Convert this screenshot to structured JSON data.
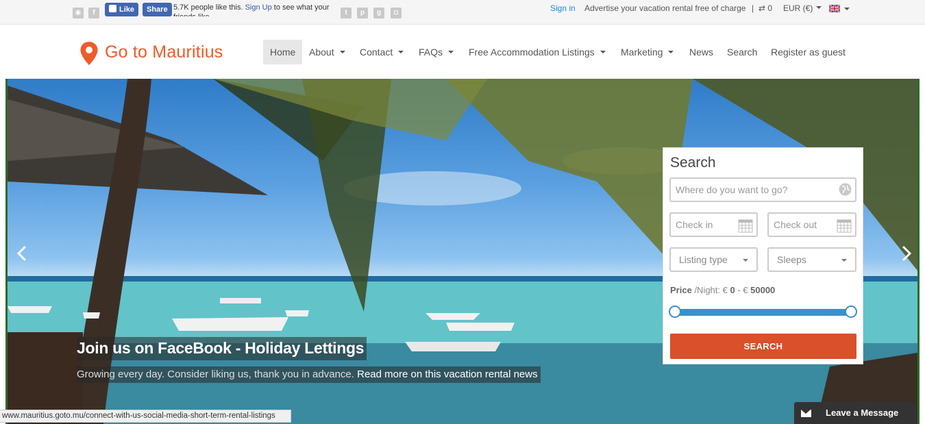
{
  "topbar": {
    "facebook": {
      "like_label": "Like",
      "share_label": "Share",
      "text_count": "5.7K people like this.",
      "text_signup": "Sign Up",
      "text_rest": "to see what your friends like."
    },
    "signin": "Sign in",
    "advertise": "Advertise your vacation rental free of charge",
    "compare_count": "0",
    "currency": "EUR (€)"
  },
  "header": {
    "logo_text": "Go to Mauritius",
    "nav": [
      {
        "label": "Home",
        "active": true
      },
      {
        "label": "About",
        "dropdown": true
      },
      {
        "label": "Contact",
        "dropdown": true
      },
      {
        "label": "FAQs",
        "dropdown": true
      },
      {
        "label": "Free Accommodation Listings",
        "dropdown": true
      },
      {
        "label": "Marketing",
        "dropdown": true
      },
      {
        "label": "News"
      },
      {
        "label": "Search"
      },
      {
        "label": "Register as guest"
      }
    ]
  },
  "hero": {
    "title": "Join us on FaceBook - Holiday Lettings",
    "subtitle": "Growing every day. Consider liking us, thank you in advance.",
    "read_more": "Read more on this vacation rental news"
  },
  "search": {
    "title": "Search",
    "where_placeholder": "Where do you want to go?",
    "checkin_placeholder": "Check in",
    "checkout_placeholder": "Check out",
    "listing_type": "Listing type",
    "sleeps": "Sleeps",
    "price_label": "Price",
    "price_unit": "/Night: €",
    "price_min": "0",
    "price_sep": "- €",
    "price_max": "50000",
    "button": "SEARCH"
  },
  "status_url": "www.mauritius.goto.mu/connect-with-us-social-media-short-term-rental-listings",
  "chat": {
    "label": "Leave a Message"
  },
  "colors": {
    "brand": "#f05a28",
    "button": "#d9502a",
    "slider": "#3d8fc8",
    "link": "#1a8fd2"
  }
}
